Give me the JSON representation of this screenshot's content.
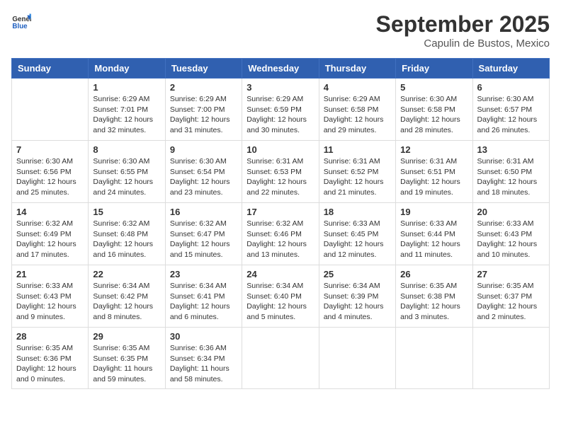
{
  "logo": {
    "text_general": "General",
    "text_blue": "Blue"
  },
  "title": {
    "main": "September 2025",
    "sub": "Capulin de Bustos, Mexico"
  },
  "days_of_week": [
    "Sunday",
    "Monday",
    "Tuesday",
    "Wednesday",
    "Thursday",
    "Friday",
    "Saturday"
  ],
  "weeks": [
    [
      {
        "day": "",
        "info": ""
      },
      {
        "day": "1",
        "info": "Sunrise: 6:29 AM\nSunset: 7:01 PM\nDaylight: 12 hours\nand 32 minutes."
      },
      {
        "day": "2",
        "info": "Sunrise: 6:29 AM\nSunset: 7:00 PM\nDaylight: 12 hours\nand 31 minutes."
      },
      {
        "day": "3",
        "info": "Sunrise: 6:29 AM\nSunset: 6:59 PM\nDaylight: 12 hours\nand 30 minutes."
      },
      {
        "day": "4",
        "info": "Sunrise: 6:29 AM\nSunset: 6:58 PM\nDaylight: 12 hours\nand 29 minutes."
      },
      {
        "day": "5",
        "info": "Sunrise: 6:30 AM\nSunset: 6:58 PM\nDaylight: 12 hours\nand 28 minutes."
      },
      {
        "day": "6",
        "info": "Sunrise: 6:30 AM\nSunset: 6:57 PM\nDaylight: 12 hours\nand 26 minutes."
      }
    ],
    [
      {
        "day": "7",
        "info": "Sunrise: 6:30 AM\nSunset: 6:56 PM\nDaylight: 12 hours\nand 25 minutes."
      },
      {
        "day": "8",
        "info": "Sunrise: 6:30 AM\nSunset: 6:55 PM\nDaylight: 12 hours\nand 24 minutes."
      },
      {
        "day": "9",
        "info": "Sunrise: 6:30 AM\nSunset: 6:54 PM\nDaylight: 12 hours\nand 23 minutes."
      },
      {
        "day": "10",
        "info": "Sunrise: 6:31 AM\nSunset: 6:53 PM\nDaylight: 12 hours\nand 22 minutes."
      },
      {
        "day": "11",
        "info": "Sunrise: 6:31 AM\nSunset: 6:52 PM\nDaylight: 12 hours\nand 21 minutes."
      },
      {
        "day": "12",
        "info": "Sunrise: 6:31 AM\nSunset: 6:51 PM\nDaylight: 12 hours\nand 19 minutes."
      },
      {
        "day": "13",
        "info": "Sunrise: 6:31 AM\nSunset: 6:50 PM\nDaylight: 12 hours\nand 18 minutes."
      }
    ],
    [
      {
        "day": "14",
        "info": "Sunrise: 6:32 AM\nSunset: 6:49 PM\nDaylight: 12 hours\nand 17 minutes."
      },
      {
        "day": "15",
        "info": "Sunrise: 6:32 AM\nSunset: 6:48 PM\nDaylight: 12 hours\nand 16 minutes."
      },
      {
        "day": "16",
        "info": "Sunrise: 6:32 AM\nSunset: 6:47 PM\nDaylight: 12 hours\nand 15 minutes."
      },
      {
        "day": "17",
        "info": "Sunrise: 6:32 AM\nSunset: 6:46 PM\nDaylight: 12 hours\nand 13 minutes."
      },
      {
        "day": "18",
        "info": "Sunrise: 6:33 AM\nSunset: 6:45 PM\nDaylight: 12 hours\nand 12 minutes."
      },
      {
        "day": "19",
        "info": "Sunrise: 6:33 AM\nSunset: 6:44 PM\nDaylight: 12 hours\nand 11 minutes."
      },
      {
        "day": "20",
        "info": "Sunrise: 6:33 AM\nSunset: 6:43 PM\nDaylight: 12 hours\nand 10 minutes."
      }
    ],
    [
      {
        "day": "21",
        "info": "Sunrise: 6:33 AM\nSunset: 6:43 PM\nDaylight: 12 hours\nand 9 minutes."
      },
      {
        "day": "22",
        "info": "Sunrise: 6:34 AM\nSunset: 6:42 PM\nDaylight: 12 hours\nand 8 minutes."
      },
      {
        "day": "23",
        "info": "Sunrise: 6:34 AM\nSunset: 6:41 PM\nDaylight: 12 hours\nand 6 minutes."
      },
      {
        "day": "24",
        "info": "Sunrise: 6:34 AM\nSunset: 6:40 PM\nDaylight: 12 hours\nand 5 minutes."
      },
      {
        "day": "25",
        "info": "Sunrise: 6:34 AM\nSunset: 6:39 PM\nDaylight: 12 hours\nand 4 minutes."
      },
      {
        "day": "26",
        "info": "Sunrise: 6:35 AM\nSunset: 6:38 PM\nDaylight: 12 hours\nand 3 minutes."
      },
      {
        "day": "27",
        "info": "Sunrise: 6:35 AM\nSunset: 6:37 PM\nDaylight: 12 hours\nand 2 minutes."
      }
    ],
    [
      {
        "day": "28",
        "info": "Sunrise: 6:35 AM\nSunset: 6:36 PM\nDaylight: 12 hours\nand 0 minutes."
      },
      {
        "day": "29",
        "info": "Sunrise: 6:35 AM\nSunset: 6:35 PM\nDaylight: 11 hours\nand 59 minutes."
      },
      {
        "day": "30",
        "info": "Sunrise: 6:36 AM\nSunset: 6:34 PM\nDaylight: 11 hours\nand 58 minutes."
      },
      {
        "day": "",
        "info": ""
      },
      {
        "day": "",
        "info": ""
      },
      {
        "day": "",
        "info": ""
      },
      {
        "day": "",
        "info": ""
      }
    ]
  ]
}
